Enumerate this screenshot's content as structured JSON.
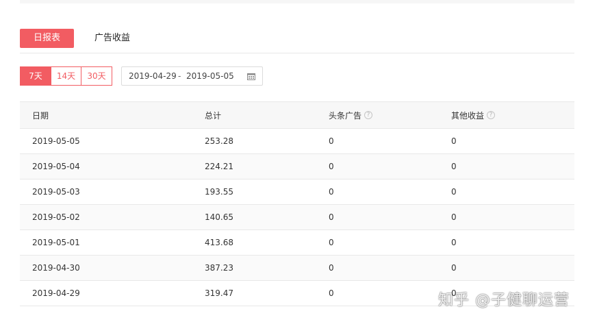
{
  "tabs": [
    {
      "label": "日报表",
      "active": true
    },
    {
      "label": "广告收益",
      "active": false
    }
  ],
  "range_buttons": [
    {
      "label": "7天",
      "active": true
    },
    {
      "label": "14天",
      "active": false
    },
    {
      "label": "30天",
      "active": false
    }
  ],
  "date_range": {
    "start": "2019-04-29",
    "separator": "-",
    "end": "2019-05-05"
  },
  "table": {
    "headers": [
      "日期",
      "总计",
      "头条广告",
      "其他收益"
    ],
    "rows": [
      [
        "2019-05-05",
        "253.28",
        "0",
        "0"
      ],
      [
        "2019-05-04",
        "224.21",
        "0",
        "0"
      ],
      [
        "2019-05-03",
        "193.55",
        "0",
        "0"
      ],
      [
        "2019-05-02",
        "140.65",
        "0",
        "0"
      ],
      [
        "2019-05-01",
        "413.68",
        "0",
        "0"
      ],
      [
        "2019-04-30",
        "387.23",
        "0",
        "0"
      ],
      [
        "2019-04-29",
        "319.47",
        "0",
        "0"
      ]
    ]
  },
  "watermark": "知乎 @子健聊运营",
  "colors": {
    "accent": "#f25c62",
    "border": "#e8e8e8",
    "header_bg": "#f7f7f7"
  }
}
